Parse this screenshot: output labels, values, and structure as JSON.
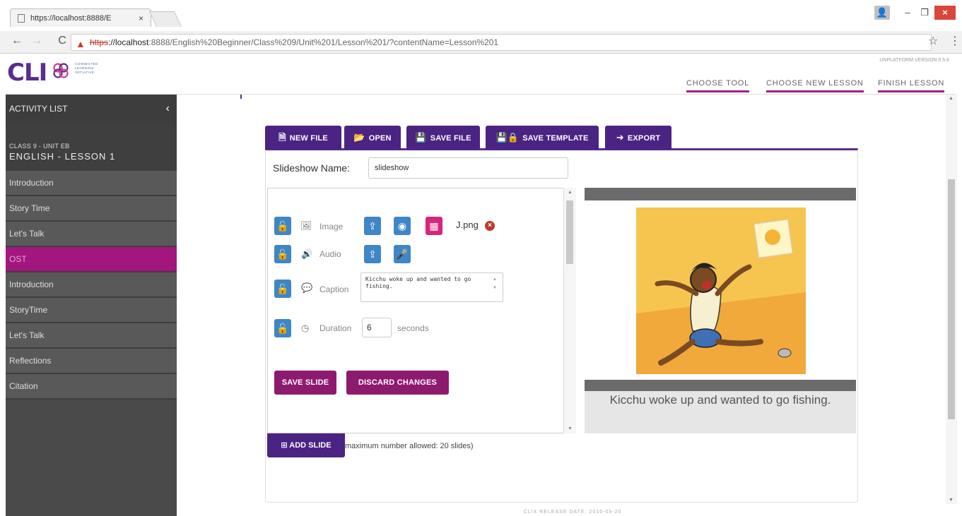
{
  "browser": {
    "tab_title": "https://localhost:8888/E",
    "url_scheme": "https",
    "url_host": "://localhost",
    "url_rest": ":8888/English%20Beginner/Class%209/Unit%201/Lesson%201/?contentName=Lesson%201"
  },
  "header": {
    "logo_text": "CLI",
    "logo_tagline": "CONNECTED LEARNING INITIATIVE",
    "version": "UNPLATFORM VERSION 0.5.6",
    "nav": [
      "CHOOSE TOOL",
      "CHOOSE NEW LESSON",
      "FINISH LESSON"
    ]
  },
  "sidebar": {
    "title": "ACTIVITY LIST",
    "class_line": "CLASS 9 - UNIT EB",
    "lesson_line": "ENGLISH - LESSON 1",
    "items": [
      {
        "label": "Introduction",
        "active": false
      },
      {
        "label": "Story Time",
        "active": false
      },
      {
        "label": "Let's Talk",
        "active": false
      },
      {
        "label": "OST",
        "active": true
      },
      {
        "label": "Introduction",
        "active": false
      },
      {
        "label": "StoryTime",
        "active": false
      },
      {
        "label": "Let's Talk",
        "active": false
      },
      {
        "label": "Reflections",
        "active": false
      },
      {
        "label": "Citation",
        "active": false
      }
    ]
  },
  "toolbar": {
    "new_file": "NEW FILE",
    "open": "OPEN",
    "save_file": "SAVE FILE",
    "save_template": "SAVE TEMPLATE",
    "export": "EXPORT"
  },
  "slideshow": {
    "name_label": "Slideshow Name:",
    "name_value": "slideshow"
  },
  "slide_editor": {
    "image_label": "Image",
    "image_file": "J.png",
    "audio_label": "Audio",
    "caption_label": "Caption",
    "caption_value": "Kicchu woke up and wanted to go fishing.",
    "duration_label": "Duration",
    "duration_value": "6",
    "duration_unit": "seconds",
    "save_slide": "SAVE SLIDE",
    "discard_changes": "DISCARD CHANGES"
  },
  "preview": {
    "caption": "Kicchu woke up and wanted to go fishing."
  },
  "add_slide": {
    "label": "ADD SLIDE",
    "note": "maximum number allowed: 20 slides)"
  },
  "footer": {
    "text": "CLIX RELEASE DATE: 2016-09-20"
  },
  "colors": {
    "primary_purple": "#4b2383",
    "magenta": "#a3157f",
    "action_button": "#8e1a6f",
    "icon_blue": "#3f86c6",
    "icon_pink": "#d6267e"
  }
}
